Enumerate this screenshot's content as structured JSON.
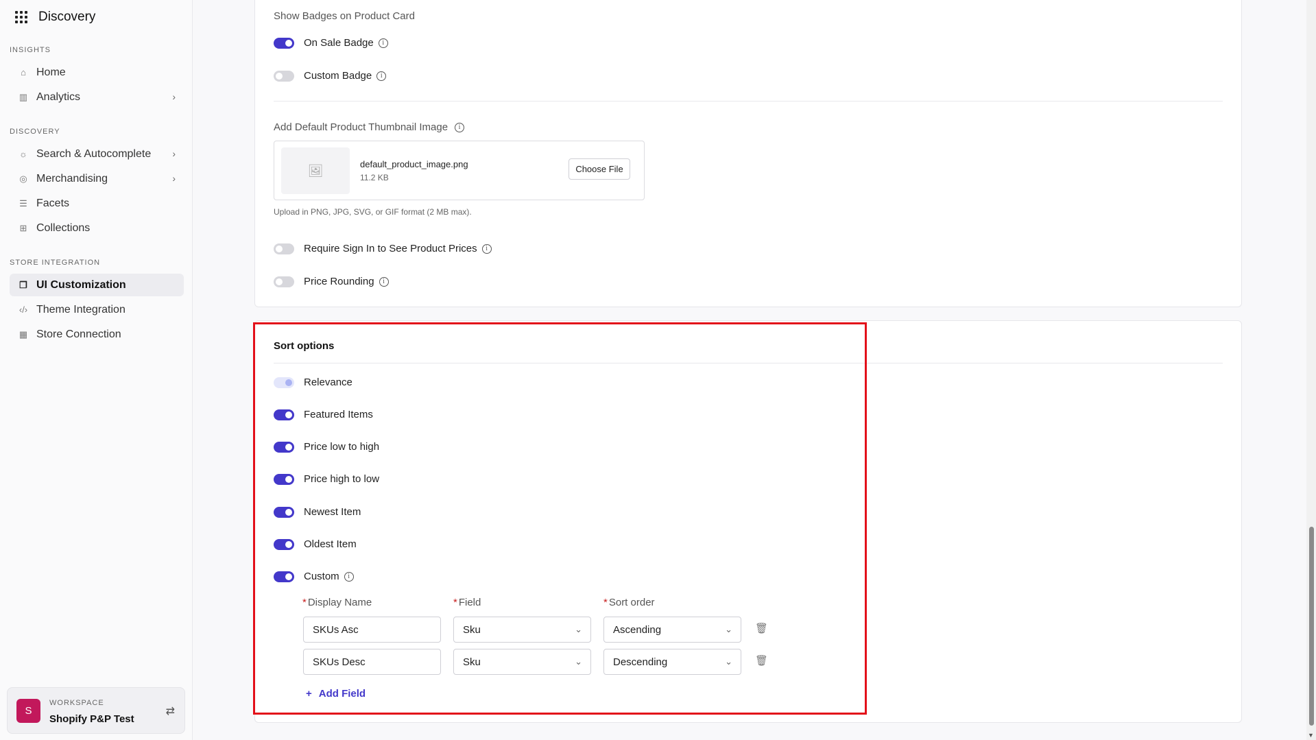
{
  "app": {
    "title": "Discovery"
  },
  "sidebar": {
    "sections": [
      {
        "label": "INSIGHTS"
      },
      {
        "label": "DISCOVERY"
      },
      {
        "label": "STORE INTEGRATION"
      }
    ],
    "items": [
      {
        "label": "Home",
        "icon": "home-icon"
      },
      {
        "label": "Analytics",
        "icon": "bar-chart-icon"
      },
      {
        "label": "Search & Autocomplete",
        "icon": "lightbulb-icon"
      },
      {
        "label": "Merchandising",
        "icon": "search-target-icon"
      },
      {
        "label": "Facets",
        "icon": "list-icon"
      },
      {
        "label": "Collections",
        "icon": "collections-icon"
      },
      {
        "label": "UI Customization",
        "icon": "copy-icon"
      },
      {
        "label": "Theme Integration",
        "icon": "code-icon"
      },
      {
        "label": "Store Connection",
        "icon": "store-icon"
      }
    ],
    "workspace": {
      "label": "WORKSPACE",
      "avatar": "S",
      "name": "Shopify P&P Test"
    }
  },
  "badges": {
    "heading": "Show Badges on Product Card",
    "on_sale": {
      "label": "On Sale Badge",
      "on": true
    },
    "custom": {
      "label": "Custom Badge",
      "on": false
    }
  },
  "thumbnail": {
    "heading": "Add Default Product Thumbnail Image",
    "file_name": "default_product_image.png",
    "file_size": "11.2 KB",
    "choose_label": "Choose File",
    "hint": "Upload in PNG, JPG, SVG, or GIF format (2 MB max)."
  },
  "pricing": {
    "require_signin": {
      "label": "Require Sign In to See Product Prices",
      "on": false
    },
    "rounding": {
      "label": "Price Rounding",
      "on": false
    }
  },
  "sort": {
    "title": "Sort options",
    "options": [
      {
        "label": "Relevance",
        "state": "disabled"
      },
      {
        "label": "Featured Items",
        "state": "on"
      },
      {
        "label": "Price low to high",
        "state": "on"
      },
      {
        "label": "Price high to low",
        "state": "on"
      },
      {
        "label": "Newest Item",
        "state": "on"
      },
      {
        "label": "Oldest Item",
        "state": "on"
      },
      {
        "label": "Custom",
        "state": "on"
      }
    ],
    "columns": {
      "display_name": "Display Name",
      "field": "Field",
      "sort_order": "Sort order"
    },
    "rows": [
      {
        "display_name": "SKUs Asc",
        "field": "Sku",
        "sort_order": "Ascending"
      },
      {
        "display_name": "SKUs Desc",
        "field": "Sku",
        "sort_order": "Descending"
      }
    ],
    "add_label": "Add Field"
  },
  "colors": {
    "accent": "#4338ca",
    "highlight": "#e3101a",
    "avatar": "#c2185b"
  }
}
